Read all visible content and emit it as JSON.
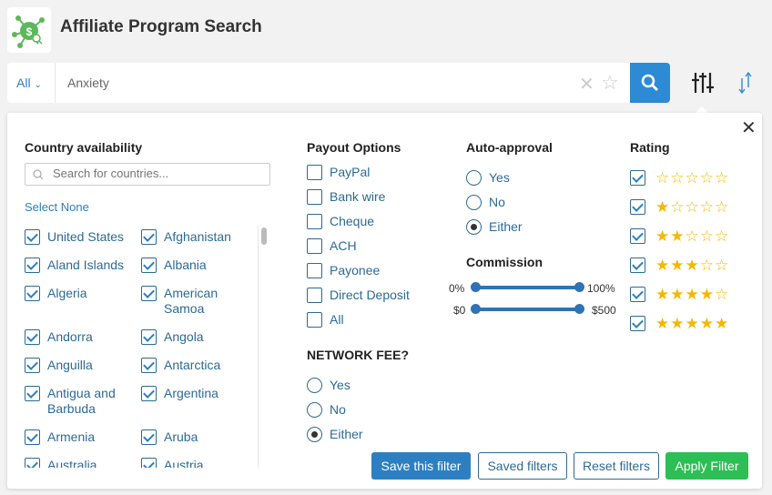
{
  "app": {
    "title": "Affiliate Program Search"
  },
  "search": {
    "scope": "All",
    "query": "Anxiety"
  },
  "country": {
    "heading": "Country availability",
    "placeholder": "Search for countries...",
    "select_none": "Select None",
    "items": [
      {
        "label": "United States",
        "checked": true
      },
      {
        "label": "Afghanistan",
        "checked": true
      },
      {
        "label": "Aland Islands",
        "checked": true
      },
      {
        "label": "Albania",
        "checked": true
      },
      {
        "label": "Algeria",
        "checked": true
      },
      {
        "label": "American Samoa",
        "checked": true
      },
      {
        "label": "Andorra",
        "checked": true
      },
      {
        "label": "Angola",
        "checked": true
      },
      {
        "label": "Anguilla",
        "checked": true
      },
      {
        "label": "Antarctica",
        "checked": true
      },
      {
        "label": "Antigua and Barbuda",
        "checked": true
      },
      {
        "label": "Argentina",
        "checked": true
      },
      {
        "label": "Armenia",
        "checked": true
      },
      {
        "label": "Aruba",
        "checked": true
      },
      {
        "label": "Australia",
        "checked": true
      },
      {
        "label": "Austria",
        "checked": true
      }
    ]
  },
  "payout": {
    "heading": "Payout Options",
    "items": [
      {
        "label": "PayPal",
        "checked": false
      },
      {
        "label": "Bank wire",
        "checked": false
      },
      {
        "label": "Cheque",
        "checked": false
      },
      {
        "label": "ACH",
        "checked": false
      },
      {
        "label": "Payonee",
        "checked": false
      },
      {
        "label": "Direct Deposit",
        "checked": false
      },
      {
        "label": "All",
        "checked": false
      }
    ]
  },
  "network_fee": {
    "heading": "NETWORK FEE?",
    "options": [
      "Yes",
      "No",
      "Either"
    ],
    "selected": "Either"
  },
  "auto_approval": {
    "heading": "Auto-approval",
    "options": [
      "Yes",
      "No",
      "Either"
    ],
    "selected": "Either"
  },
  "commission": {
    "heading": "Commission",
    "percent": {
      "min_label": "0%",
      "max_label": "100%",
      "min": 0,
      "max": 100
    },
    "amount": {
      "min_label": "$0",
      "max_label": "$500",
      "min": 0,
      "max": 500
    }
  },
  "rating": {
    "heading": "Rating",
    "items": [
      {
        "stars": 0,
        "checked": true
      },
      {
        "stars": 1,
        "checked": true
      },
      {
        "stars": 2,
        "checked": true
      },
      {
        "stars": 3,
        "checked": true
      },
      {
        "stars": 4,
        "checked": true
      },
      {
        "stars": 5,
        "checked": true
      }
    ]
  },
  "buttons": {
    "save": "Save this filter",
    "saved": "Saved filters",
    "reset": "Reset filters",
    "apply": "Apply Filter"
  },
  "colors": {
    "primary": "#2d8ad4",
    "apply": "#2dbf55",
    "star": "#f5b800",
    "logo": "#5cb85c"
  }
}
